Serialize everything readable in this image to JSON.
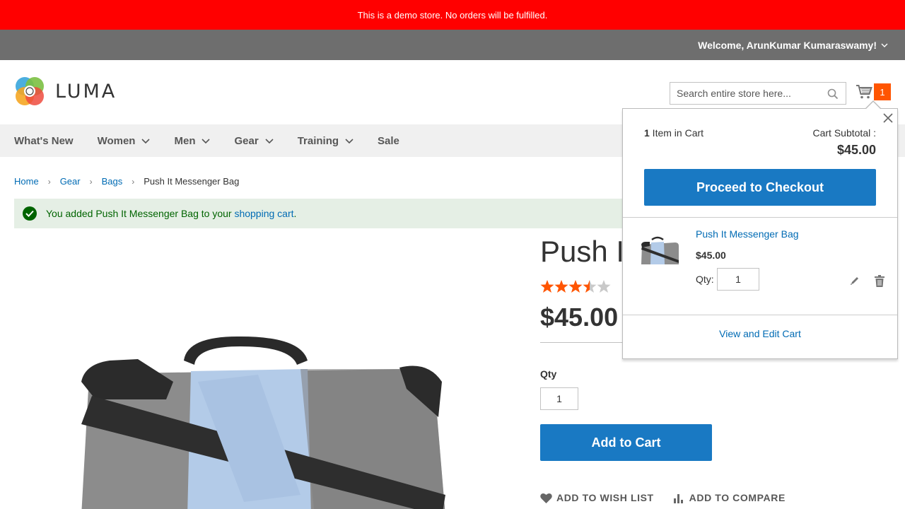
{
  "demo_notice": "This is a demo store. No orders will be fulfilled.",
  "header": {
    "welcome": "Welcome, ArunKumar Kumaraswamy!",
    "logo_text": "LUMA",
    "search_placeholder": "Search entire store here...",
    "cart_count": "1"
  },
  "nav": {
    "items": [
      {
        "label": "What's New"
      },
      {
        "label": "Women"
      },
      {
        "label": "Men"
      },
      {
        "label": "Gear"
      },
      {
        "label": "Training"
      },
      {
        "label": "Sale"
      }
    ]
  },
  "breadcrumbs": [
    "Home",
    "Gear",
    "Bags",
    "Push It Messenger Bag"
  ],
  "message": {
    "text": "You added Push It Messenger Bag to your ",
    "link": "shopping cart",
    "end": "."
  },
  "product": {
    "title": "Push It Messenger Bag",
    "title_visible": "Push It",
    "rating_stars": 3.5,
    "rating_max": 5,
    "price": "$45.00",
    "qty_label": "Qty",
    "qty_value": "1",
    "add_to_cart": "Add to Cart",
    "wish_list": "ADD TO WISH LIST",
    "compare": "ADD TO COMPARE"
  },
  "minicart": {
    "count": "1",
    "count_label": " Item in Cart",
    "subtotal_label": "Cart Subtotal :",
    "subtotal": "$45.00",
    "checkout": "Proceed to Checkout",
    "item_name": "Push It Messenger Bag",
    "item_price": "$45.00",
    "qty_label": "Qty:",
    "qty_value": "1",
    "view_edit": "View and Edit Cart"
  },
  "colors": {
    "demo_bar": "#ff0000",
    "panel_bar": "#6e6e6e",
    "primary_button": "#1979c3",
    "link": "#006bb4",
    "counter": "#ff5501",
    "star": "#ff5501",
    "success_bg": "#e5efe5"
  }
}
